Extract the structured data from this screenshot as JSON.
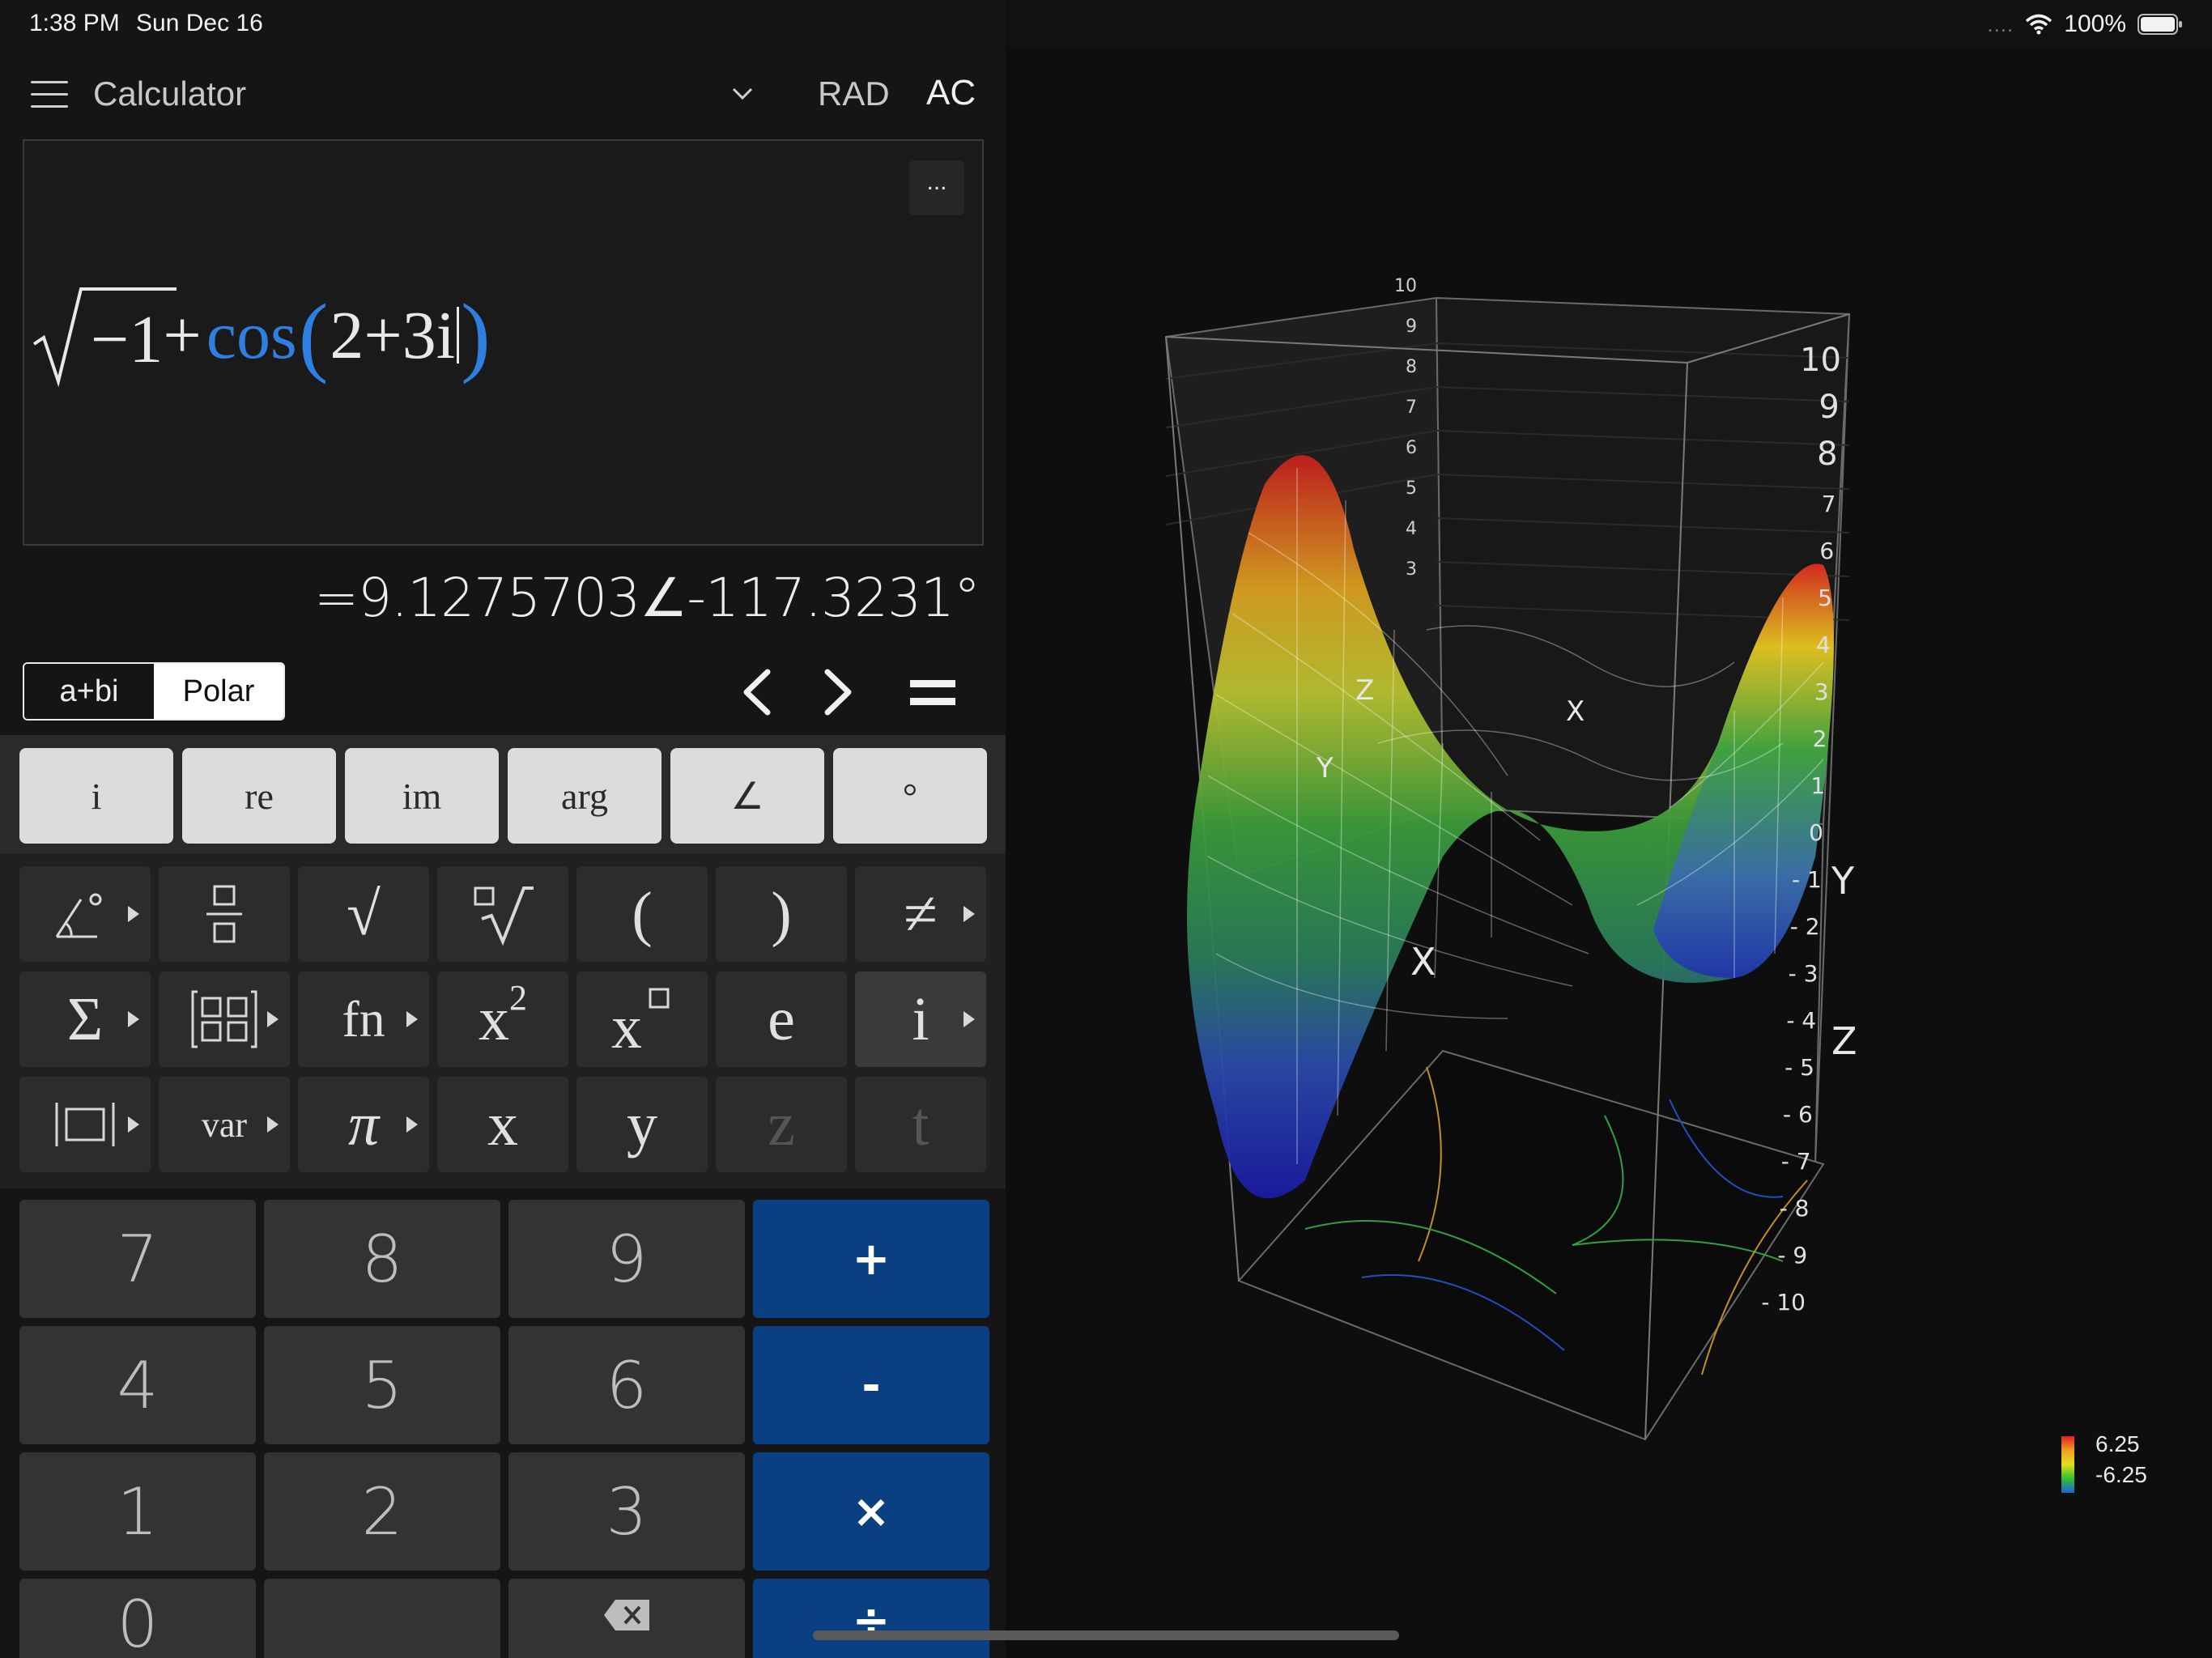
{
  "status_bar": {
    "time": "1:38 PM",
    "date": "Sun Dec 16",
    "signal_dots": "....",
    "battery_percent": "100%"
  },
  "toolbar": {
    "title": "Calculator",
    "angle_mode": "RAD",
    "clear_label": "AC"
  },
  "editor": {
    "more_label": "...",
    "expr_radicand": "−1",
    "expr_plus": "+",
    "expr_fn": "cos",
    "expr_open": "(",
    "expr_argument": "2+3i",
    "expr_close": ")"
  },
  "result": "=9.1275703∠-117.3231°",
  "mode_toggle": {
    "rect_label": "a+bi",
    "polar_label": "Polar",
    "selected": "Polar"
  },
  "special_keys": [
    "i",
    "re",
    "im",
    "arg",
    "∠",
    "°"
  ],
  "function_keys": {
    "row1": [
      "∠°",
      "fraction",
      "√",
      "ⁿ√",
      "(",
      ")",
      "≠"
    ],
    "row2": [
      "Σ",
      "matrix",
      "fn",
      "x²",
      "xⁿ",
      "e",
      "i"
    ],
    "row3": [
      "abs",
      "var",
      "π",
      "x",
      "y",
      "z",
      "t"
    ]
  },
  "number_keys": {
    "rows": [
      [
        "7",
        "8",
        "9",
        "+"
      ],
      [
        "4",
        "5",
        "6",
        "-"
      ],
      [
        "1",
        "2",
        "3",
        "×"
      ],
      [
        "0",
        "",
        "⌫",
        "÷"
      ]
    ]
  },
  "graph": {
    "axis_x_label": "X",
    "axis_y_label": "Y",
    "axis_z_label": "Z",
    "z_ticks_right": [
      "10",
      "9",
      "8",
      "7",
      "6",
      "5",
      "4",
      "3",
      "2",
      "1",
      "0",
      "- 1",
      "- 2",
      "- 3",
      "- 4",
      "- 5",
      "- 6",
      "- 7",
      "- 8",
      "- 9",
      "- 10"
    ],
    "z_ticks_back": [
      "10",
      "9",
      "8",
      "7",
      "6",
      "5",
      "4",
      "3"
    ],
    "colorbar_max": "6.25",
    "colorbar_min": "-6.25",
    "colors": {
      "high": "#d02020",
      "mid_high": "#e0d020",
      "mid": "#30a040",
      "low": "#2040c0"
    }
  }
}
